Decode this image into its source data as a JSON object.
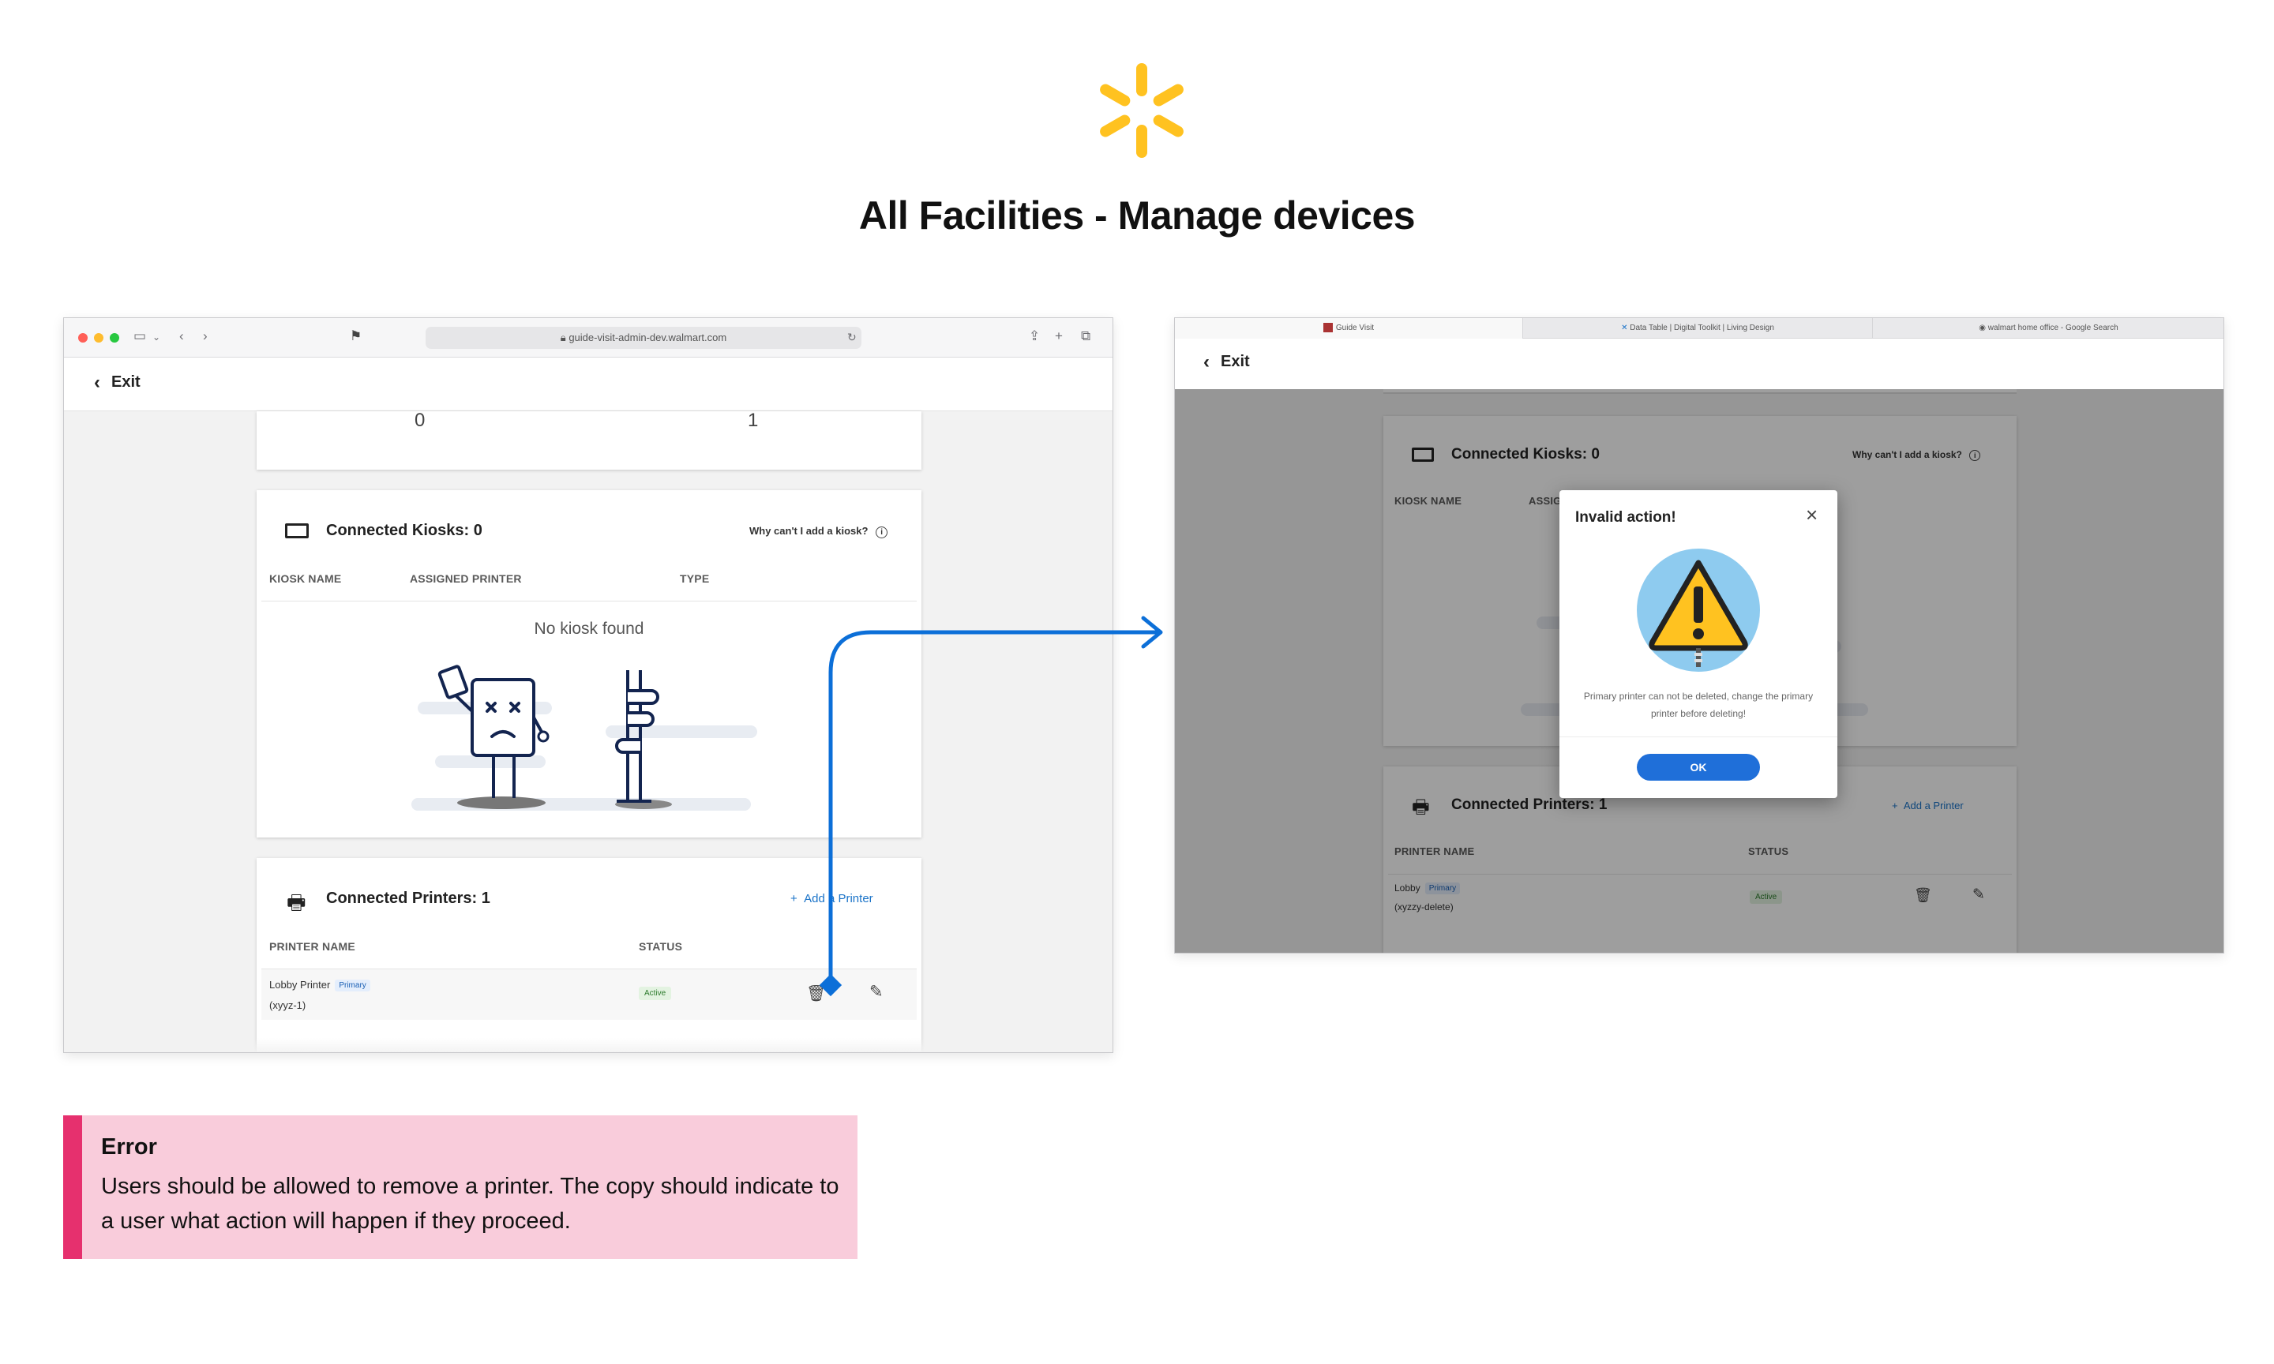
{
  "page": {
    "title": "All Facilities - Manage devices"
  },
  "colors": {
    "walmart_yellow": "#ffc220",
    "link_blue": "#1a73c8",
    "connector_blue": "#0c6fd8",
    "error_accent": "#e6306e",
    "error_bg": "#f9ccdb"
  },
  "left_screen": {
    "url": "guide-visit-admin-dev.walmart.com",
    "exit_label": "Exit",
    "stats_partial": [
      "0",
      "1"
    ],
    "kiosks": {
      "title": "Connected Kiosks: 0",
      "help_link": "Why can't I add a kiosk?",
      "columns": [
        "KIOSK NAME",
        "ASSIGNED PRINTER",
        "TYPE"
      ],
      "empty_text": "No kiosk found"
    },
    "printers": {
      "title": "Connected Printers: 1",
      "add_label": "Add a Printer",
      "columns": [
        "PRINTER NAME",
        "STATUS"
      ],
      "rows": [
        {
          "name": "Lobby Printer",
          "badge": "Primary",
          "id": "(xyyz-1)",
          "status": "Active"
        }
      ]
    }
  },
  "right_screen": {
    "tabs": [
      "Guide Visit",
      "Data Table | Digital Toolkit | Living Design",
      "walmart home office - Google Search"
    ],
    "exit_label": "Exit",
    "kiosks": {
      "title": "Connected Kiosks: 0",
      "help_link": "Why can't I add a kiosk?",
      "column_first": "KIOSK NAME",
      "column_partial": "ASSIG"
    },
    "printers": {
      "title": "Connected Printers: 1",
      "add_label": "Add a Printer",
      "columns": [
        "PRINTER NAME",
        "STATUS"
      ],
      "row": {
        "name": "Lobby",
        "badge": "Primary",
        "id": "(xyzzy-delete)",
        "status": "Active"
      }
    },
    "modal": {
      "title": "Invalid action!",
      "message": "Primary printer can not be deleted, change the primary printer before deleting!",
      "ok_label": "OK"
    }
  },
  "note": {
    "title": "Error",
    "body": "Users should be allowed to remove a printer. The copy should indicate to a user what action will happen if they proceed."
  }
}
